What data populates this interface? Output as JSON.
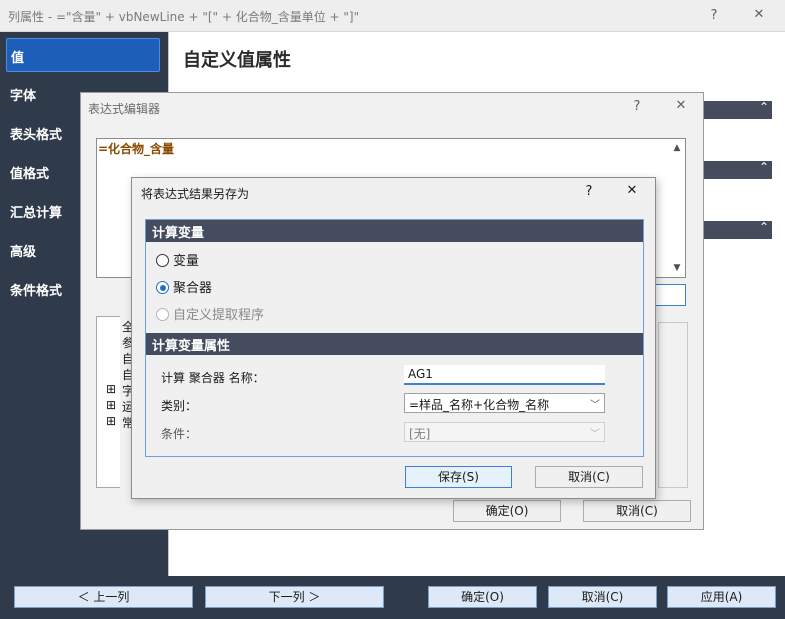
{
  "outer": {
    "title": "列属性 - =\"含量\" + vbNewLine + \"[\" + 化合物_含量单位 + \"]\"",
    "help_glyph": "?",
    "close_glyph": "✕",
    "nav": [
      "值",
      "字体",
      "表头格式",
      "值格式",
      "汇总计算",
      "高级",
      "条件格式"
    ],
    "active_nav": "值",
    "content_title": "自定义值属性",
    "section_chevron": "⌃",
    "bottom_buttons": {
      "prev": "＜ 上一列",
      "next": "下一列 ＞",
      "ok": "确定(O)",
      "cancel": "取消(C)",
      "apply": "应用(A)"
    }
  },
  "expression_editor": {
    "title": "表达式编辑器",
    "help_glyph": "?",
    "close_glyph": "✕",
    "expression": "=化合物_含量",
    "tree_items": [
      "全",
      "参",
      "自",
      "自",
      "字",
      "运",
      "常"
    ],
    "ok_label": "确定(O)",
    "cancel_label": "取消(C)"
  },
  "save_dialog": {
    "title": "将表达式结果另存为",
    "help_glyph": "?",
    "close_glyph": "✕",
    "group_calc_var": "计算变量",
    "radio_variable": "变量",
    "radio_aggregator": "聚合器",
    "radio_custom_extractor": "自定义提取程序",
    "group_props": "计算变量属性",
    "name_label": "计算 聚合器 名称：",
    "name_value": "AG1",
    "category_label": "类别：",
    "category_value": "=样品_名称+化合物_名称",
    "condition_label": "条件：",
    "condition_value": "[无]",
    "save_label": "保存(S)",
    "cancel_label": "取消(C)"
  }
}
